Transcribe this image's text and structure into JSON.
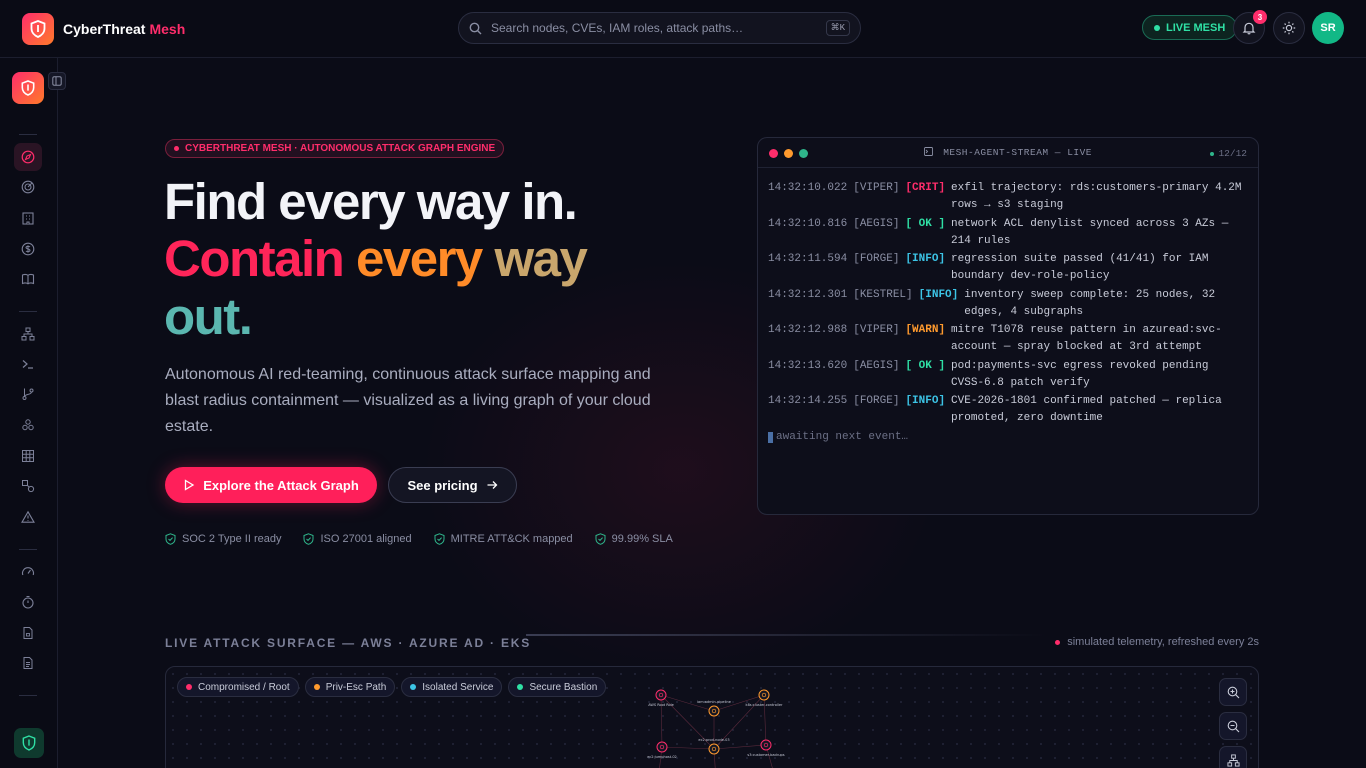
{
  "app": {
    "name": "CyberThreat",
    "name_accent": "Mesh"
  },
  "search": {
    "placeholder": "Search nodes, CVEs, IAM roles, attack paths…",
    "shortcut": "⌘K"
  },
  "header": {
    "live_label": "LIVE MESH",
    "notifications_count": "3",
    "avatar_initials": "SR"
  },
  "sidebar": {
    "items": [
      {
        "icon": "compass-icon",
        "active": true
      },
      {
        "icon": "radar-icon"
      },
      {
        "icon": "building-icon"
      },
      {
        "icon": "dollar-icon"
      },
      {
        "icon": "book-icon"
      },
      {
        "icon": "network-icon"
      },
      {
        "icon": "terminal-icon"
      },
      {
        "icon": "git-branch-icon"
      },
      {
        "icon": "cluster-icon"
      },
      {
        "icon": "grid-icon"
      },
      {
        "icon": "shapes-icon"
      },
      {
        "icon": "alert-triangle-icon"
      },
      {
        "icon": "gauge-icon"
      },
      {
        "icon": "timer-icon"
      },
      {
        "icon": "file-lock-icon"
      },
      {
        "icon": "file-text-icon"
      }
    ]
  },
  "hero": {
    "eyebrow": "CYBERTHREAT MESH · AUTONOMOUS ATTACK GRAPH ENGINE",
    "line1": "Find every way in.",
    "line2_a": "Contain",
    "line2_b": "every",
    "line2_c": "way",
    "line3": "out.",
    "subtitle": "Autonomous AI red-teaming, continuous attack surface mapping and blast radius containment — visualized as a living graph of your cloud estate.",
    "cta_primary": "Explore the Attack Graph",
    "cta_secondary": "See pricing",
    "certs": [
      "SOC 2 Type II ready",
      "ISO 27001 aligned",
      "MITRE ATT&CK mapped",
      "99.99% SLA"
    ]
  },
  "terminal": {
    "title": "MESH-AGENT-STREAM — LIVE",
    "count": "12/12",
    "logs": [
      {
        "ts": "14:32:10.022",
        "agent": "[VIPER]",
        "level": "[CRIT]",
        "kind": "crit",
        "msg": "exfil trajectory: rds:customers-primary 4.2M rows → s3 staging"
      },
      {
        "ts": "14:32:10.816",
        "agent": "[AEGIS]",
        "level": "[ OK ]",
        "kind": "ok",
        "msg": "network ACL denylist synced across 3 AZs — 214 rules"
      },
      {
        "ts": "14:32:11.594",
        "agent": "[FORGE]",
        "level": "[INFO]",
        "kind": "info",
        "msg": "regression suite passed (41/41) for IAM boundary dev-role-policy"
      },
      {
        "ts": "14:32:12.301",
        "agent": "[KESTREL]",
        "level": "[INFO]",
        "kind": "info",
        "msg": "inventory sweep complete: 25 nodes, 32 edges, 4 subgraphs"
      },
      {
        "ts": "14:32:12.988",
        "agent": "[VIPER]",
        "level": "[WARN]",
        "kind": "warn",
        "msg": "mitre T1078 reuse pattern in azuread:svc-account — spray blocked at 3rd attempt"
      },
      {
        "ts": "14:32:13.620",
        "agent": "[AEGIS]",
        "level": "[ OK ]",
        "kind": "ok",
        "msg": "pod:payments-svc egress revoked pending CVSS-6.8 patch verify"
      },
      {
        "ts": "14:32:14.255",
        "agent": "[FORGE]",
        "level": "[INFO]",
        "kind": "info",
        "msg": "CVE-2026-1801 confirmed patched — replica promoted, zero downtime"
      }
    ],
    "awaiting": "awaiting next event…"
  },
  "surface": {
    "title": "LIVE ATTACK SURFACE — AWS · AZURE AD · EKS",
    "note": "simulated telemetry, refreshed every 2s",
    "legend": [
      {
        "label": "Compromised / Root",
        "color": "#ff2d6b"
      },
      {
        "label": "Priv-Esc Path",
        "color": "#ff9a2e"
      },
      {
        "label": "Isolated Service",
        "color": "#3cc4e6"
      },
      {
        "label": "Secure Bastion",
        "color": "#2fe0a5"
      }
    ],
    "nodes": [
      {
        "label": "AWS Root Role",
        "color": "#ff2d6b"
      },
      {
        "label": "iam:admin-pipeline",
        "color": "#ff9a2e"
      },
      {
        "label": "k8s:cluster-controller",
        "color": "#ff9a2e"
      },
      {
        "label": "ec2:jumphost-02",
        "color": "#ff2d6b"
      },
      {
        "label": "ec2:prod-node-03",
        "color": "#ff9a2e"
      },
      {
        "label": "s3:customer-backups",
        "color": "#ff2d6b"
      }
    ]
  },
  "colors": {
    "accent": "#ff1f5a",
    "brand_gradient_start": "#ff2d6b",
    "brand_gradient_end": "#ff7a2a",
    "live_green": "#2fe0a5"
  }
}
